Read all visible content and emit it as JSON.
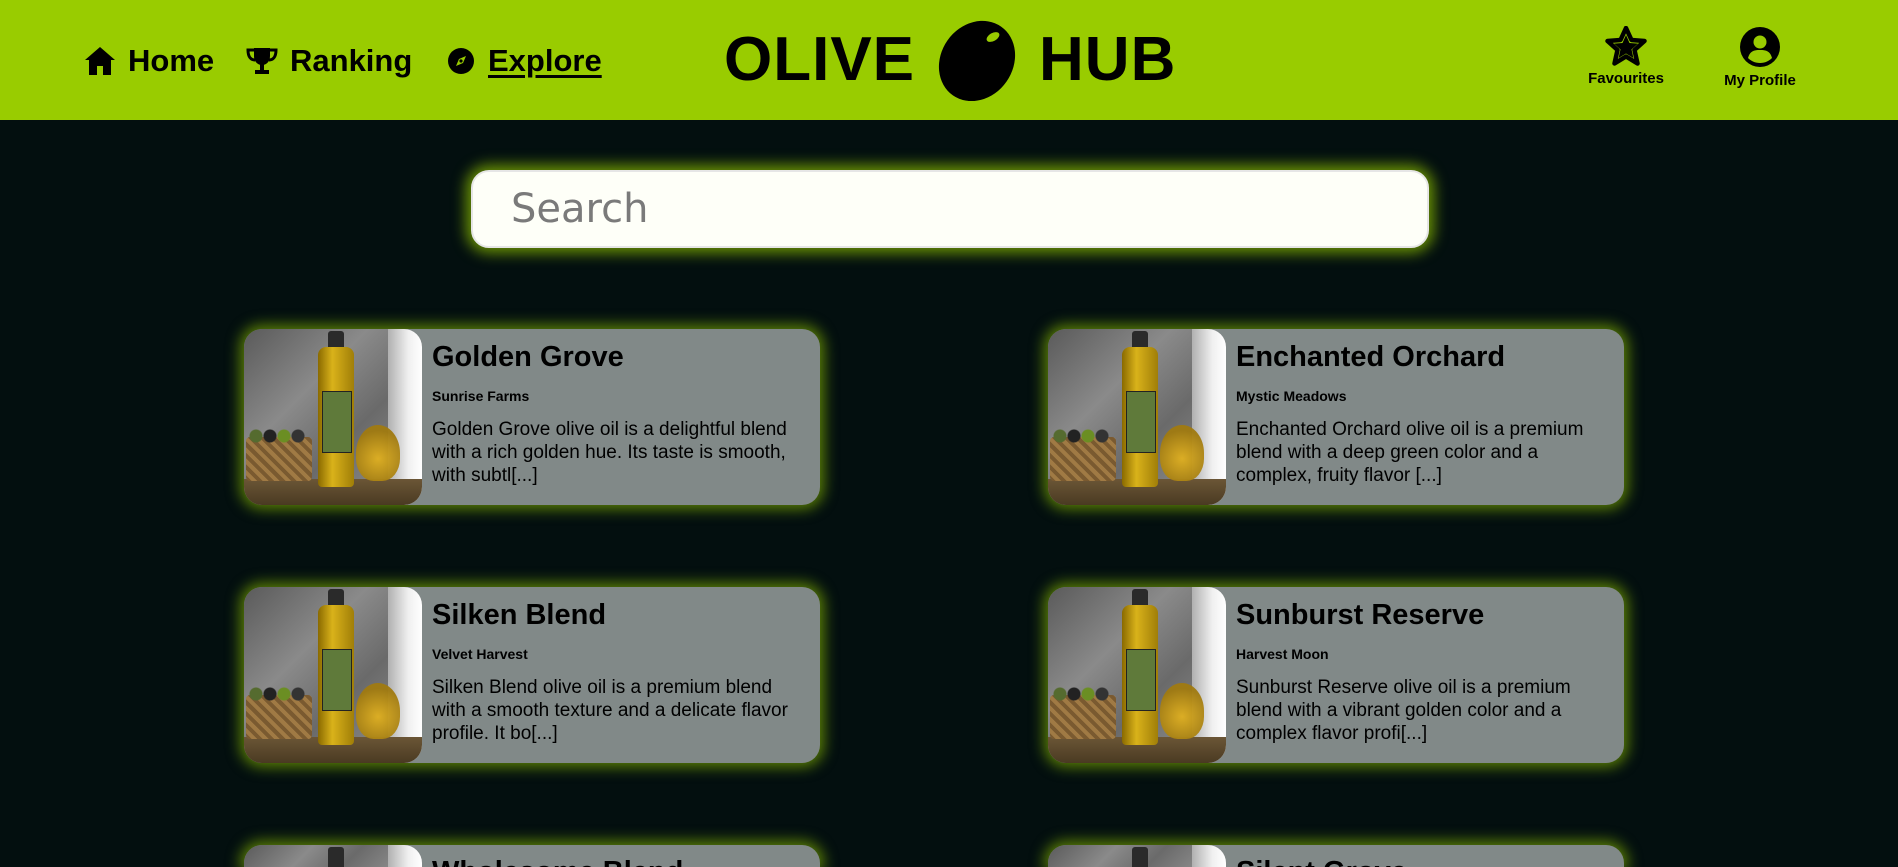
{
  "nav": {
    "home": "Home",
    "ranking": "Ranking",
    "explore": "Explore"
  },
  "logo": {
    "left": "OLIVE",
    "right": "HUB"
  },
  "actions": {
    "favourites": "Favourites",
    "profile": "My Profile"
  },
  "search": {
    "placeholder": "Search",
    "value": ""
  },
  "oils": [
    {
      "name": "Golden Grove",
      "producer": "Sunrise Farms",
      "description": "Golden Grove olive oil is a delightful blend with a rich golden hue. Its taste is smooth, with subtl[...]"
    },
    {
      "name": "Enchanted Orchard",
      "producer": "Mystic Meadows",
      "description": "Enchanted Orchard olive oil is a premium blend with a deep green color and a complex, fruity flavor [...]"
    },
    {
      "name": "Silken Blend",
      "producer": "Velvet Harvest",
      "description": "Silken Blend olive oil is a premium blend with a smooth texture and a delicate flavor profile. It bo[...]"
    },
    {
      "name": "Sunburst Reserve",
      "producer": "Harvest Moon",
      "description": "Sunburst Reserve olive oil is a premium blend with a vibrant golden color and a complex flavor profi[...]"
    },
    {
      "name": "Wholesome Blend",
      "producer": "",
      "description": ""
    },
    {
      "name": "Silent Grove",
      "producer": "",
      "description": ""
    }
  ],
  "colors": {
    "accent": "#99cc00",
    "background": "#030f0f",
    "card": "#818988"
  }
}
